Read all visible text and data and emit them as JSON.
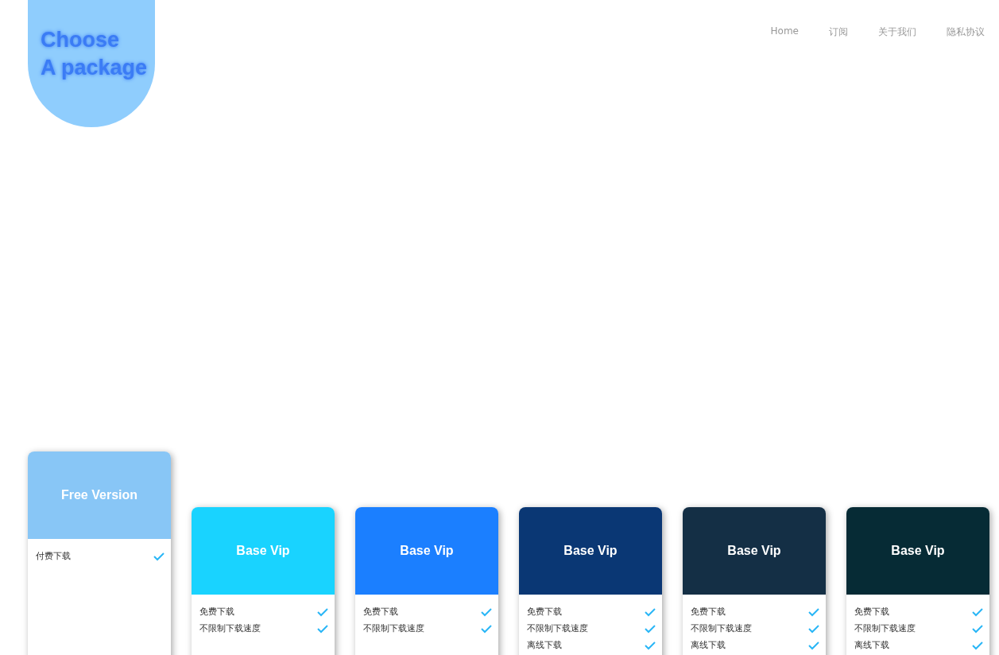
{
  "logo": {
    "lines": [
      "Choose",
      "A package"
    ]
  },
  "nav": [
    {
      "label": "Home"
    },
    {
      "label": "订阅"
    },
    {
      "label": "关于我们"
    },
    {
      "label": "隐私协议"
    }
  ],
  "plans": [
    {
      "title": "Free Version",
      "color": "#88c6f6",
      "selected": true,
      "features": [
        "付费下载"
      ]
    },
    {
      "title": "Base Vip",
      "color": "#19d3ff",
      "selected": false,
      "features": [
        "免费下载",
        "不限制下载速度"
      ]
    },
    {
      "title": "Base Vip",
      "color": "#1b7fff",
      "selected": false,
      "features": [
        "免费下载",
        "不限制下载速度"
      ]
    },
    {
      "title": "Base Vip",
      "color": "#0a3774",
      "selected": false,
      "features": [
        "免费下载",
        "不限制下载速度",
        "离线下载"
      ]
    },
    {
      "title": "Base Vip",
      "color": "#142f45",
      "selected": false,
      "features": [
        "免费下载",
        "不限制下载速度",
        "离线下载"
      ]
    },
    {
      "title": "Base Vip",
      "color": "#062b35",
      "selected": false,
      "features": [
        "免费下载",
        "不限制下载速度",
        "离线下载"
      ]
    }
  ]
}
